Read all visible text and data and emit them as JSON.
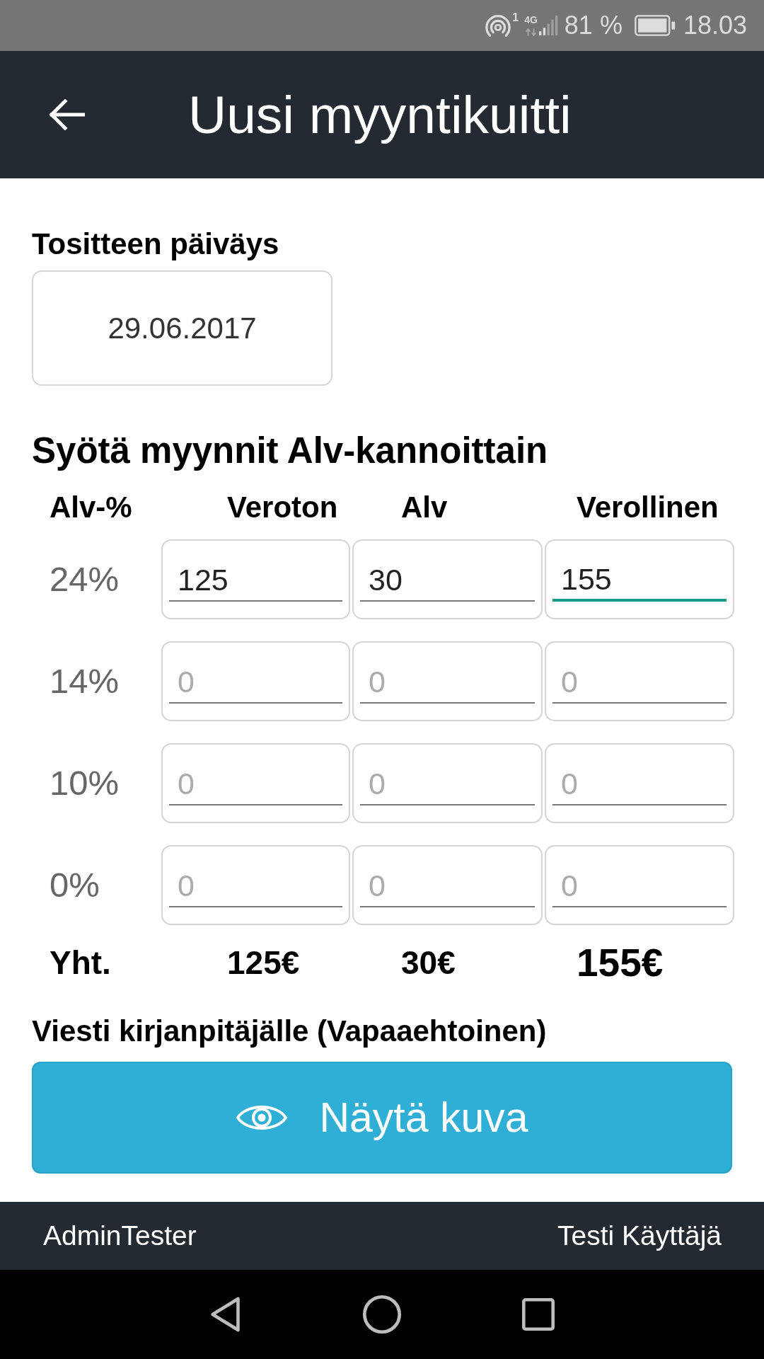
{
  "status_bar": {
    "sim_label": "1",
    "network": "4G",
    "battery": "81 %",
    "time": "18.03"
  },
  "header": {
    "title": "Uusi myyntikuitti"
  },
  "date": {
    "label": "Tositteen päiväys",
    "value": "29.06.2017"
  },
  "sales": {
    "title": "Syötä myynnit Alv-kannoittain",
    "columns": [
      "Alv-%",
      "Veroton",
      "Alv",
      "Verollinen"
    ],
    "rows": [
      {
        "rate": "24%",
        "cells": [
          {
            "value": "125",
            "focused": false
          },
          {
            "value": "30",
            "focused": false
          },
          {
            "value": "155",
            "focused": true
          }
        ]
      },
      {
        "rate": "14%",
        "cells": [
          {
            "placeholder": "0",
            "focused": false
          },
          {
            "placeholder": "0",
            "focused": false
          },
          {
            "placeholder": "0",
            "focused": false
          }
        ]
      },
      {
        "rate": "10%",
        "cells": [
          {
            "placeholder": "0",
            "focused": false
          },
          {
            "placeholder": "0",
            "focused": false
          },
          {
            "placeholder": "0",
            "focused": false
          }
        ]
      },
      {
        "rate": "0%",
        "cells": [
          {
            "placeholder": "0",
            "focused": false
          },
          {
            "placeholder": "0",
            "focused": false
          },
          {
            "placeholder": "0",
            "focused": false
          }
        ]
      }
    ],
    "totals": {
      "label": "Yht.",
      "values": [
        {
          "value": "125€",
          "emphasized": false
        },
        {
          "value": "30€",
          "emphasized": false
        },
        {
          "value": "155€",
          "emphasized": true
        }
      ]
    }
  },
  "message": {
    "label": "Viesti kirjanpitäjälle (Vapaaehtoinen)"
  },
  "show_image_button": {
    "label": "Näytä kuva"
  },
  "footer": {
    "left": "AdminTester",
    "right": "Testi Käyttäjä"
  }
}
